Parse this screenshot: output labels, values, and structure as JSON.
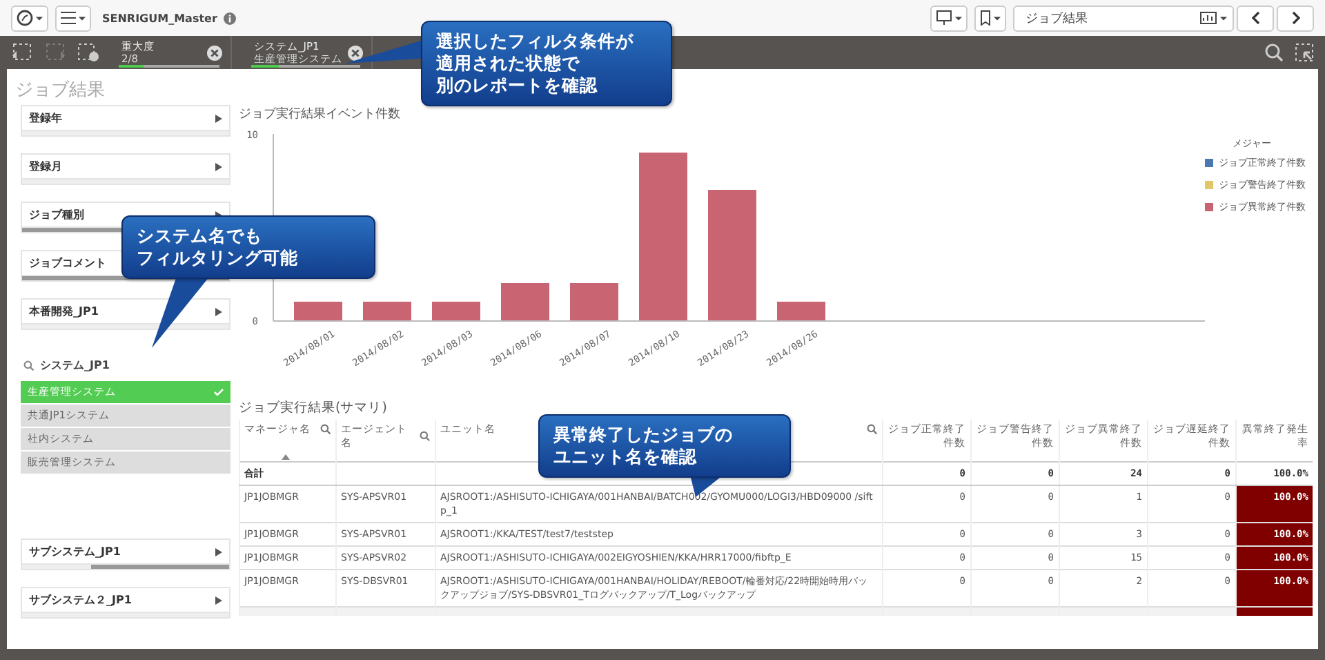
{
  "toolbar": {
    "app_name": "SENRIGUM_Master",
    "sheet_title": "ジョブ結果"
  },
  "selections": [
    {
      "field": "重大度",
      "value": "2/8",
      "level": 0.25
    },
    {
      "field": "システム_JP1",
      "value": "生産管理システム",
      "level": 0.25
    }
  ],
  "sheet": {
    "title": "ジョブ結果"
  },
  "filters_top": [
    {
      "label": "登録年"
    },
    {
      "label": "登録月"
    },
    {
      "label": "ジョブ種別",
      "level": 1
    },
    {
      "label": "ジョブコメント",
      "level": 1
    },
    {
      "label": "本番開発_JP1"
    }
  ],
  "list_filter": {
    "title": "システム_JP1",
    "items": [
      {
        "label": "生産管理システム",
        "selected": true
      },
      {
        "label": "共通JP1システム",
        "selected": false
      },
      {
        "label": "社内システム",
        "selected": false
      },
      {
        "label": "販売管理システム",
        "selected": false
      }
    ]
  },
  "filters_bottom": [
    {
      "label": "サブシステム_JP1",
      "level": 0.67
    },
    {
      "label": "サブシステム２_JP1"
    }
  ],
  "chart": {
    "title": "ジョブ実行結果イベント件数",
    "legend_title": "メジャー",
    "chart_data": {
      "type": "bar",
      "categories": [
        "2014/08/01",
        "2014/08/02",
        "2014/08/03",
        "2014/08/06",
        "2014/08/07",
        "2014/08/10",
        "2014/08/23",
        "2014/08/26"
      ],
      "series": [
        {
          "name": "ジョブ正常終了件数",
          "color": "#4a78b0",
          "values": [
            0,
            0,
            0,
            0,
            0,
            0,
            0,
            0
          ]
        },
        {
          "name": "ジョブ警告終了件数",
          "color": "#e0c868",
          "values": [
            0,
            0,
            0,
            0,
            0,
            0,
            0,
            0
          ]
        },
        {
          "name": "ジョブ異常終了件数",
          "color": "#c96472",
          "values": [
            1,
            1,
            1,
            2,
            2,
            9,
            7,
            1
          ]
        }
      ],
      "ylim": [
        0,
        10
      ],
      "yticks": [
        0,
        10
      ]
    }
  },
  "table": {
    "title": "ジョブ実行結果(サマリ)",
    "columns": [
      {
        "label": "マネージャ名",
        "search": true,
        "sorted": true
      },
      {
        "label": "エージェント名",
        "search": true,
        "sorted": false
      },
      {
        "label": "ユニット名",
        "search": true,
        "sorted": false
      },
      {
        "label": "ジョブ正常終了件数",
        "search": false,
        "sorted": false
      },
      {
        "label": "ジョブ警告終了件数",
        "search": false,
        "sorted": false
      },
      {
        "label": "ジョブ異常終了件数",
        "search": false,
        "sorted": false
      },
      {
        "label": "ジョブ遅延終了件数",
        "search": false,
        "sorted": false
      },
      {
        "label": "異常終了発生率",
        "search": false,
        "sorted": false
      }
    ],
    "total": {
      "label": "合計",
      "values": [
        "0",
        "0",
        "24",
        "0",
        "100.0%"
      ]
    },
    "rows": [
      [
        "JP1JOBMGR",
        "SYS-APSVR01",
        "AJSROOT1:/ASHISUTO-ICHIGAYA/001HANBAI/BATCH002/GYOMU000/LOGI3/HBD09000 /siftp_1",
        "0",
        "0",
        "1",
        "0",
        "100.0%"
      ],
      [
        "JP1JOBMGR",
        "SYS-APSVR01",
        "AJSROOT1:/KKA/TEST/test7/teststep",
        "0",
        "0",
        "3",
        "0",
        "100.0%"
      ],
      [
        "JP1JOBMGR",
        "SYS-APSVR02",
        "AJSROOT1:/ASHISUTO-ICHIGAYA/002EIGYOSHIEN/KKA/HRR17000/fibftp_E",
        "0",
        "0",
        "15",
        "0",
        "100.0%"
      ],
      [
        "JP1JOBMGR",
        "SYS-DBSVR01",
        "AJSROOT1:/ASHISUTO-ICHIGAYA/001HANBAI/HOLIDAY/REBOOT/輪番対応/22時開始時用バックアップジョブ/SYS-DBSVR01_Tログバックアップ/T_Logバックアップ",
        "0",
        "0",
        "2",
        "0",
        "100.0%"
      ]
    ]
  },
  "callouts": [
    {
      "lines": [
        "選択したフィルタ条件が",
        "適用された状態で",
        "別のレポートを確認"
      ],
      "kind": "left"
    },
    {
      "lines": [
        "システム名でも",
        "フィルタリング可能"
      ],
      "kind": "down-left"
    },
    {
      "lines": [
        "異常終了したジョブの",
        "ユニット名を確認"
      ],
      "kind": "down"
    }
  ]
}
